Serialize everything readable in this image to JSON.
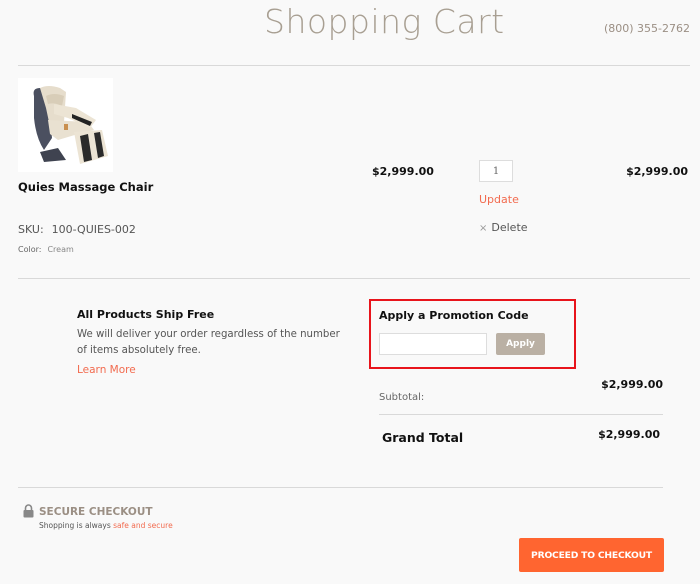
{
  "header": {
    "title": "Shopping Cart",
    "phone": "(800) 355-2762"
  },
  "cart_item": {
    "name": "Quies Massage Chair",
    "image_alt": "massage-chair-image",
    "sku_label": "SKU:",
    "sku_value": "100-QUIES-002",
    "color_label": "Color:",
    "color_value": "Cream",
    "unit_price": "$2,999.00",
    "quantity": "1",
    "update_label": "Update",
    "delete_icon": "×",
    "delete_label": "Delete",
    "line_total": "$2,999.00"
  },
  "shipping": {
    "title": "All Products Ship Free",
    "description": "We will deliver your order regardless of the number of items absolutely free.",
    "link_label": "Learn More"
  },
  "promo": {
    "title": "Apply a Promotion Code",
    "input_value": "",
    "input_placeholder": "",
    "apply_label": "Apply",
    "highlight_color": "#e8141c"
  },
  "totals": {
    "subtotal_label": "Subtotal:",
    "subtotal_value": "$2,999.00",
    "grand_total_label": "Grand Total",
    "grand_total_value": "$2,999.00"
  },
  "secure": {
    "icon": "lock-icon",
    "title": "SECURE CHECKOUT",
    "desc_prefix": "Shopping is always ",
    "desc_highlight": "safe and secure"
  },
  "checkout": {
    "button_label": "PROCEED TO CHECKOUT",
    "button_color": "#ff6530"
  },
  "colors": {
    "accent": "#f26b4f",
    "title": "#a89f92",
    "apply_button": "#bab0a4"
  }
}
